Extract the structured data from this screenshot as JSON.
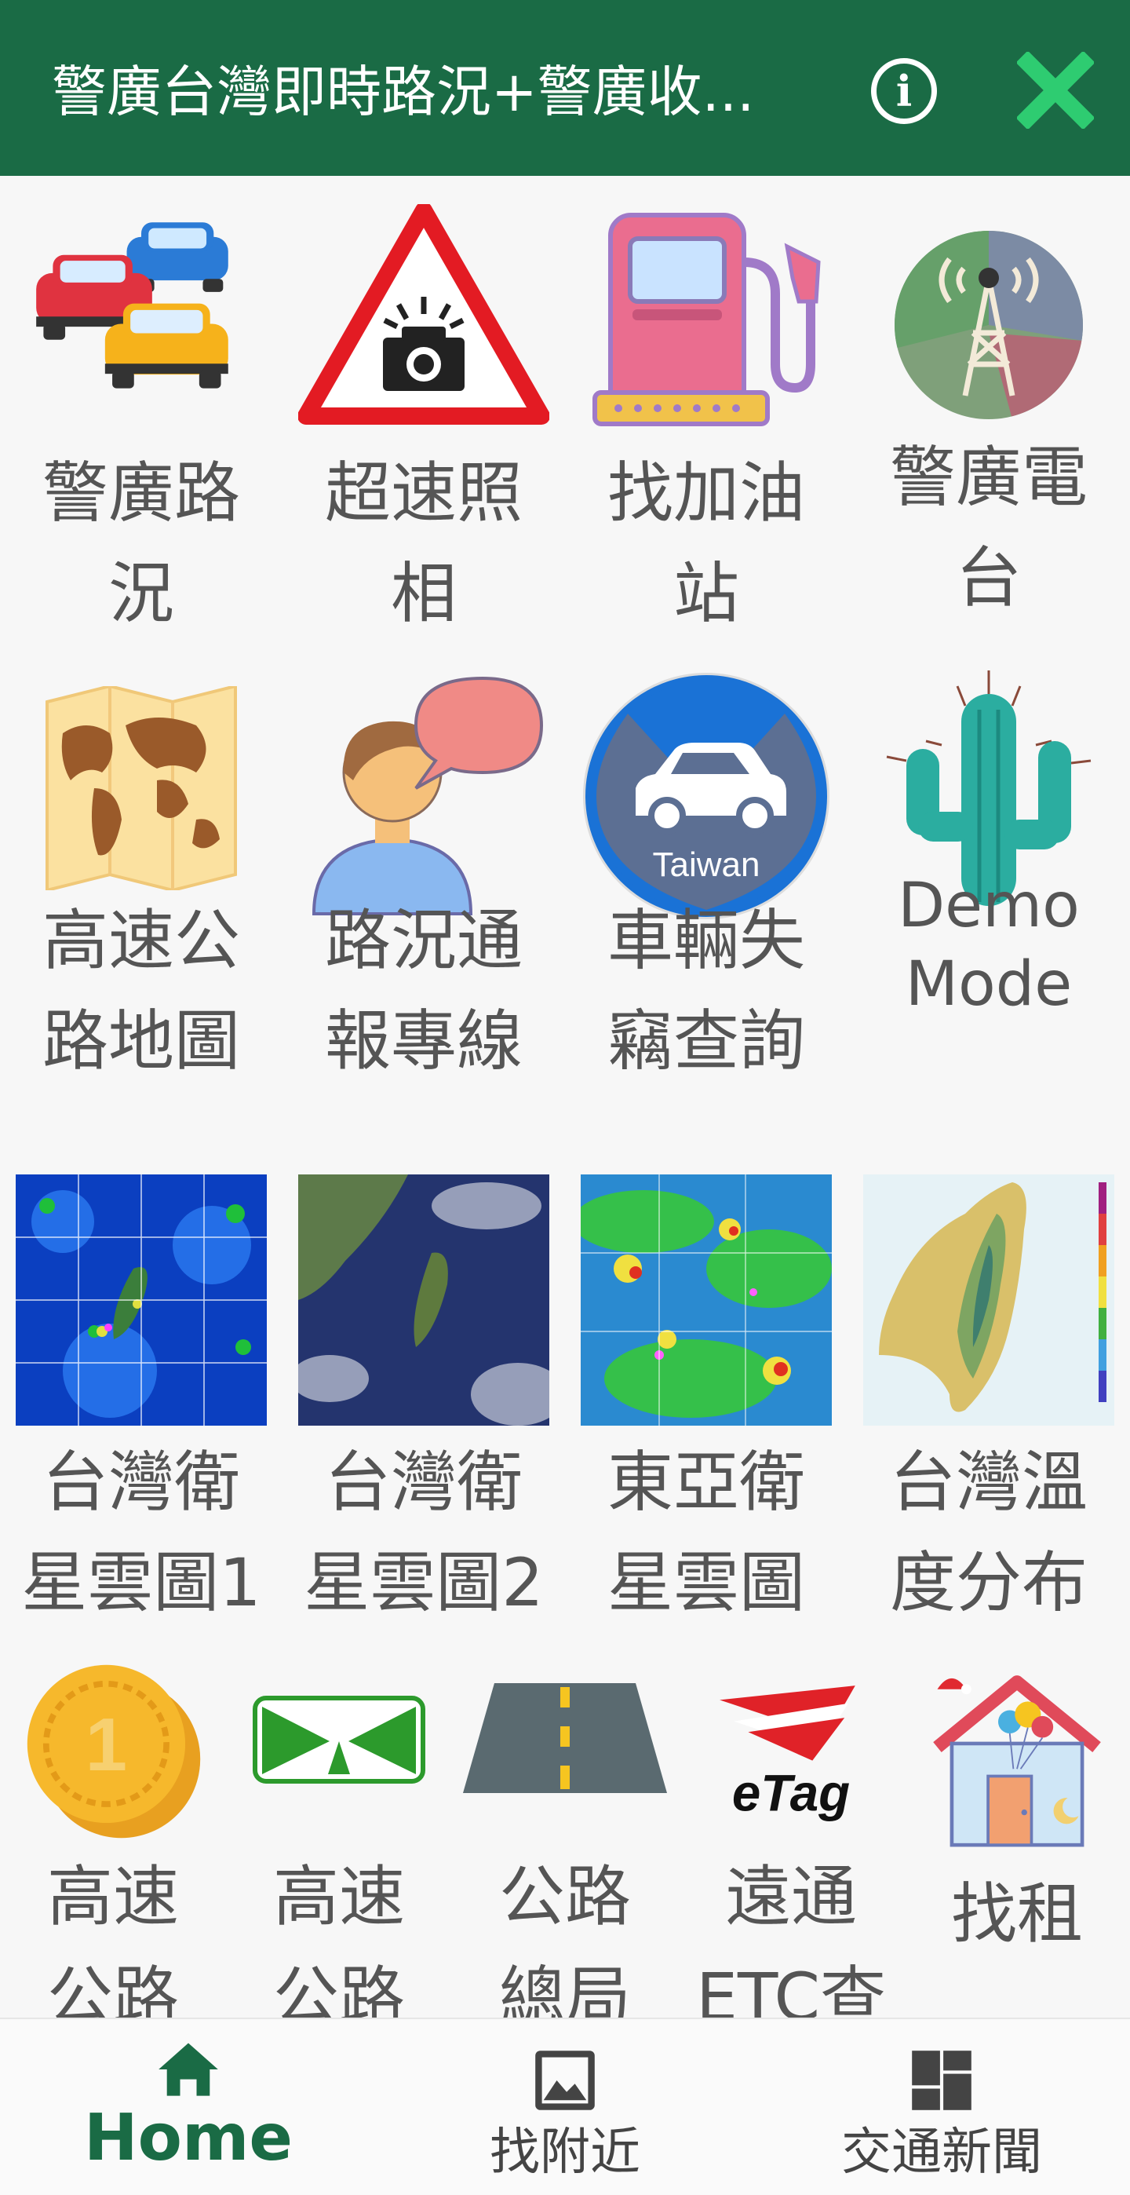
{
  "app_bar": {
    "title": "警廣台灣即時路況+警廣收...",
    "info_icon": "info-icon",
    "close_icon": "close-icon",
    "color": "#1a6b45",
    "close_color": "#2ecc71"
  },
  "grid": {
    "row1": [
      {
        "label_line1": "警廣路",
        "label_line2": "況",
        "icon": "traffic-cars-icon"
      },
      {
        "label_line1": "超速照",
        "label_line2": "相",
        "icon": "speed-camera-warning-icon"
      },
      {
        "label_line1": "找加油",
        "label_line2": "站",
        "icon": "gas-pump-icon"
      },
      {
        "label_line1": "警廣電",
        "label_line2": "台",
        "icon": "radio-tower-icon"
      }
    ],
    "row2": [
      {
        "label_line1": "高速公",
        "label_line2": "路地圖",
        "icon": "map-icon"
      },
      {
        "label_line1": "路況通",
        "label_line2": "報專線",
        "icon": "person-speech-icon"
      },
      {
        "label_line1": "車輛失",
        "label_line2": "竊查詢",
        "icon": "car-taiwan-badge-icon",
        "badge_text": "Taiwan"
      },
      {
        "label_line1": "Demo",
        "label_line2": "Mode",
        "icon": "cactus-icon"
      }
    ],
    "row3": [
      {
        "label_line1": "台灣衛",
        "label_line2": "星雲圖1",
        "icon": "satellite-image-1"
      },
      {
        "label_line1": "台灣衛",
        "label_line2": "星雲圖2",
        "icon": "satellite-image-2"
      },
      {
        "label_line1": "東亞衛",
        "label_line2": "星雲圖",
        "icon": "east-asia-satellite-image"
      },
      {
        "label_line1": "台灣溫",
        "label_line2": "度分布",
        "icon": "temperature-map-image"
      }
    ],
    "row4": [
      {
        "label_line1": "高速",
        "label_line2": "公路",
        "icon": "gold-coin-icon"
      },
      {
        "label_line1": "高速",
        "label_line2": "公路",
        "icon": "freeway-sign-icon"
      },
      {
        "label_line1": "公路",
        "label_line2": "總局",
        "icon": "road-icon"
      },
      {
        "label_line1": "遠通",
        "label_line2": "ETC查",
        "icon": "etag-logo-icon",
        "logo_text": "eTag"
      },
      {
        "label_line1": "找租",
        "label_line2": "",
        "icon": "house-icon"
      }
    ]
  },
  "bottom_nav": {
    "items": [
      {
        "label": "Home",
        "icon": "home-icon",
        "active": true
      },
      {
        "label": "找附近",
        "icon": "image-icon",
        "active": false
      },
      {
        "label": "交通新聞",
        "icon": "dashboard-icon",
        "active": false
      }
    ]
  }
}
